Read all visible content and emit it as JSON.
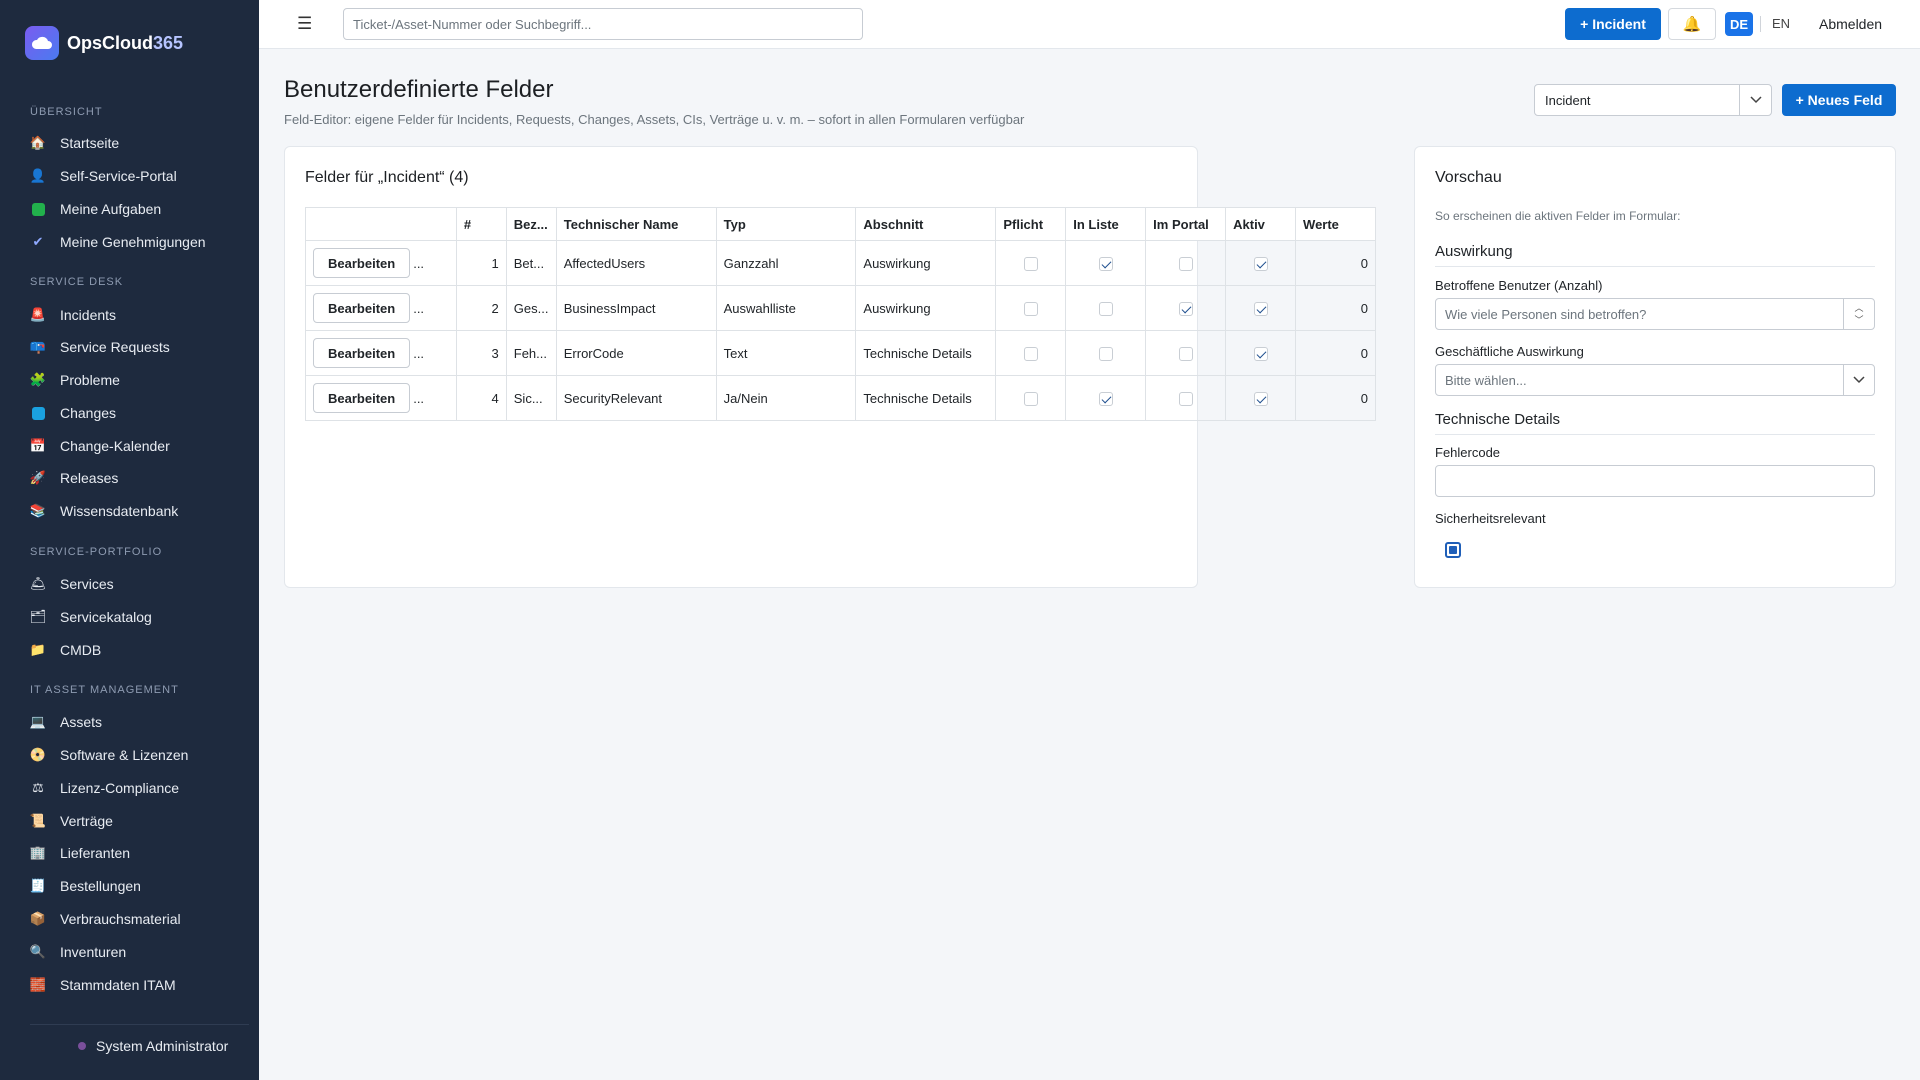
{
  "app": {
    "brand_main": "OpsCloud",
    "brand_accent": "365",
    "accent_color": "#0d6ccf"
  },
  "sidebar": {
    "sections": [
      {
        "label": "ÜBERSICHT",
        "items": [
          {
            "label": "Startseite",
            "icon": "home-icon"
          },
          {
            "label": "Self-Service-Portal",
            "icon": "person-icon"
          },
          {
            "label": "Meine Aufgaben",
            "icon": "checkbox-icon"
          },
          {
            "label": "Meine Genehmigungen",
            "icon": "checkmark-icon"
          }
        ]
      },
      {
        "label": "SERVICE DESK",
        "items": [
          {
            "label": "Incidents",
            "icon": "siren-icon"
          },
          {
            "label": "Service Requests",
            "icon": "mailbox-icon"
          },
          {
            "label": "Probleme",
            "icon": "puzzle-icon"
          },
          {
            "label": "Changes",
            "icon": "refresh-icon"
          },
          {
            "label": "Change-Kalender",
            "icon": "calendar-icon"
          },
          {
            "label": "Releases",
            "icon": "rocket-icon"
          },
          {
            "label": "Wissensdatenbank",
            "icon": "books-icon"
          }
        ]
      },
      {
        "label": "SERVICE-PORTFOLIO",
        "items": [
          {
            "label": "Services",
            "icon": "bell-service-icon"
          },
          {
            "label": "Servicekatalog",
            "icon": "catalog-icon"
          },
          {
            "label": "CMDB",
            "icon": "folder-icon"
          }
        ]
      },
      {
        "label": "IT ASSET MANAGEMENT",
        "items": [
          {
            "label": "Assets",
            "icon": "monitor-icon"
          },
          {
            "label": "Software & Lizenzen",
            "icon": "disc-icon"
          },
          {
            "label": "Lizenz-Compliance",
            "icon": "scale-icon"
          },
          {
            "label": "Verträge",
            "icon": "contract-icon"
          },
          {
            "label": "Lieferanten",
            "icon": "building-icon"
          },
          {
            "label": "Bestellungen",
            "icon": "receipt-icon"
          },
          {
            "label": "Verbrauchsmaterial",
            "icon": "package-icon"
          },
          {
            "label": "Inventuren",
            "icon": "magnifier-icon"
          },
          {
            "label": "Stammdaten ITAM",
            "icon": "bricks-icon"
          }
        ]
      }
    ],
    "user": "System Administrator"
  },
  "topbar": {
    "search_placeholder": "Ticket-/Asset-Nummer oder Suchbegriff...",
    "new_incident": "+ Incident",
    "lang_active": "DE",
    "lang_other": "EN",
    "logout": "Abmelden"
  },
  "page": {
    "title": "Benutzerdefinierte Felder",
    "subtitle": "Feld-Editor: eigene Felder für Incidents, Requests, Changes, Assets, CIs, Verträge u. v. m. – sofort in allen Formularen verfügbar",
    "entity_select": "Incident",
    "new_field": "+ Neues Feld"
  },
  "fields_card": {
    "title": "Felder für „Incident“ (4)",
    "columns": [
      "",
      "#",
      "Bez...",
      "Technischer Name",
      "Typ",
      "Abschnitt",
      "Pflicht",
      "In Liste",
      "Im Portal",
      "Aktiv",
      "Werte"
    ],
    "edit_label": "Bearbeiten",
    "more_label": "...",
    "rows": [
      {
        "no": "1",
        "label": "Bet...",
        "tech": "AffectedUsers",
        "type": "Ganzzahl",
        "section": "Auswirkung",
        "required": false,
        "in_list": true,
        "in_portal": false,
        "active": true,
        "values": "0"
      },
      {
        "no": "2",
        "label": "Ges...",
        "tech": "BusinessImpact",
        "type": "Auswahlliste",
        "section": "Auswirkung",
        "required": false,
        "in_list": false,
        "in_portal": true,
        "active": true,
        "values": "0"
      },
      {
        "no": "3",
        "label": "Feh...",
        "tech": "ErrorCode",
        "type": "Text",
        "section": "Technische Details",
        "required": false,
        "in_list": false,
        "in_portal": false,
        "active": true,
        "values": "0"
      },
      {
        "no": "4",
        "label": "Sic...",
        "tech": "SecurityRelevant",
        "type": "Ja/Nein",
        "section": "Technische Details",
        "required": false,
        "in_list": true,
        "in_portal": false,
        "active": true,
        "values": "0"
      }
    ]
  },
  "preview": {
    "title": "Vorschau",
    "hint": "So erscheinen die aktiven Felder im Formular:",
    "section1": "Auswirkung",
    "field1_label": "Betroffene Benutzer (Anzahl)",
    "field1_placeholder": "Wie viele Personen sind betroffen?",
    "field2_label": "Geschäftliche Auswirkung",
    "field2_value": "Bitte wählen...",
    "section2": "Technische Details",
    "field3_label": "Fehlercode",
    "field3_value": "",
    "field4_label": "Sicherheitsrelevant"
  }
}
